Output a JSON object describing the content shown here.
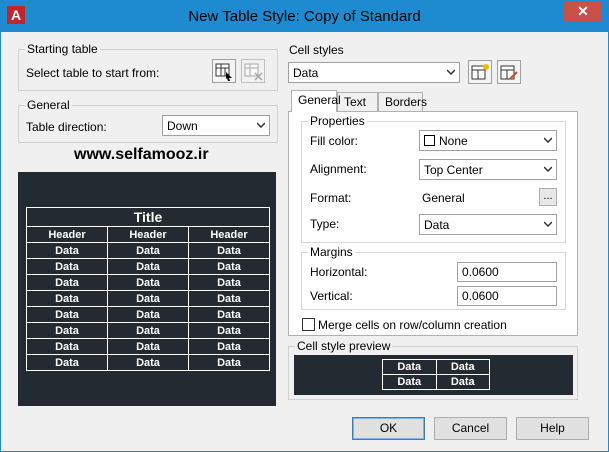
{
  "window": {
    "title": "New Table Style: Copy of Standard",
    "close_glyph": "✕",
    "app_icon_letter": "A"
  },
  "starting_table": {
    "group_label": "Starting table",
    "prompt": "Select table to start from:"
  },
  "general": {
    "group_label": "General",
    "direction_label": "Table direction:",
    "direction_value": "Down"
  },
  "watermark": "www.selfamooz.ir",
  "preview_table": {
    "title": "Title",
    "headers": [
      "Header",
      "Header",
      "Header"
    ],
    "data_cell": "Data",
    "data_rows": 8
  },
  "cell_styles": {
    "group_label": "Cell styles",
    "selected": "Data"
  },
  "tabs": [
    {
      "label": "General"
    },
    {
      "label": "Text"
    },
    {
      "label": "Borders"
    }
  ],
  "properties": {
    "group_label": "Properties",
    "fill_color_label": "Fill color:",
    "fill_color_value": "None",
    "alignment_label": "Alignment:",
    "alignment_value": "Top Center",
    "format_label": "Format:",
    "format_value": "General",
    "format_button": "...",
    "type_label": "Type:",
    "type_value": "Data"
  },
  "margins": {
    "group_label": "Margins",
    "horizontal_label": "Horizontal:",
    "horizontal_value": "0.0600",
    "vertical_label": "Vertical:",
    "vertical_value": "0.0600"
  },
  "merge_label": "Merge cells on row/column creation",
  "cell_preview": {
    "group_label": "Cell style preview",
    "cells": [
      [
        "Data",
        "Data"
      ],
      [
        "Data",
        "Data"
      ]
    ]
  },
  "buttons": {
    "ok": "OK",
    "cancel": "Cancel",
    "help": "Help"
  }
}
